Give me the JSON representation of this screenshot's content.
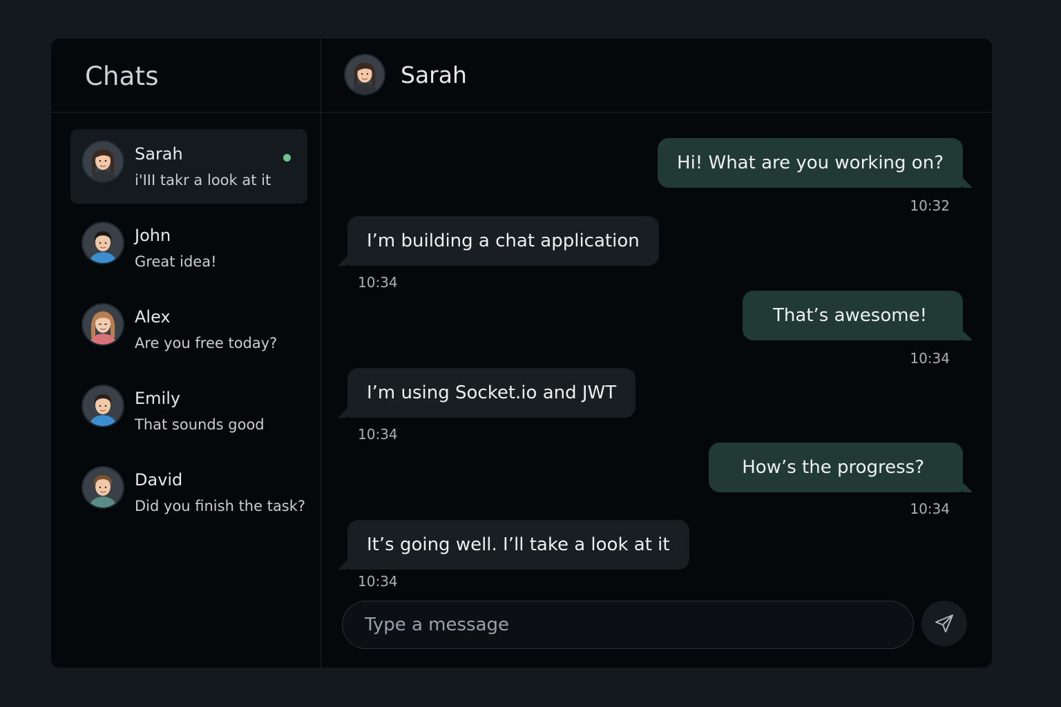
{
  "sidebar": {
    "title": "Chats",
    "chats": [
      {
        "name": "Sarah",
        "preview": "i'III takr a look at it",
        "active": true,
        "online": true,
        "avatar": "female-dark-hair-avatar-icon"
      },
      {
        "name": "John",
        "preview": "Great idea!",
        "active": false,
        "online": false,
        "avatar": "male-avatar-icon"
      },
      {
        "name": "Alex",
        "preview": "Are you free today?",
        "active": false,
        "online": false,
        "avatar": "female-light-hair-avatar-icon"
      },
      {
        "name": "Emily",
        "preview": "That sounds good",
        "active": false,
        "online": false,
        "avatar": "male-avatar-icon"
      },
      {
        "name": "David",
        "preview": "Did you finish the task?",
        "active": false,
        "online": false,
        "avatar": "male-brown-hair-avatar-icon"
      }
    ]
  },
  "conversation": {
    "contact_name": "Sarah",
    "messages": [
      {
        "direction": "out",
        "text": "Hi! What are you working on?",
        "time": "10:32"
      },
      {
        "direction": "in",
        "text": "I’m building a chat application",
        "time": "10:34"
      },
      {
        "direction": "out",
        "text": "That’s awesome!",
        "time": "10:34"
      },
      {
        "direction": "in",
        "text": "I’m using Socket.io and JWT",
        "time": "10:34"
      },
      {
        "direction": "out",
        "text": "How’s the progress?",
        "time": "10:34"
      },
      {
        "direction": "in",
        "text": "It’s going well. I’ll take a look at it",
        "time": "10:34"
      }
    ]
  },
  "composer": {
    "placeholder": "Type a message",
    "send_icon": "send-icon"
  },
  "colors": {
    "background": "#14191d",
    "panel": "#05080b",
    "outgoing_bubble": "#213a36",
    "incoming_bubble": "#191e23",
    "online": "#6fc28f"
  }
}
